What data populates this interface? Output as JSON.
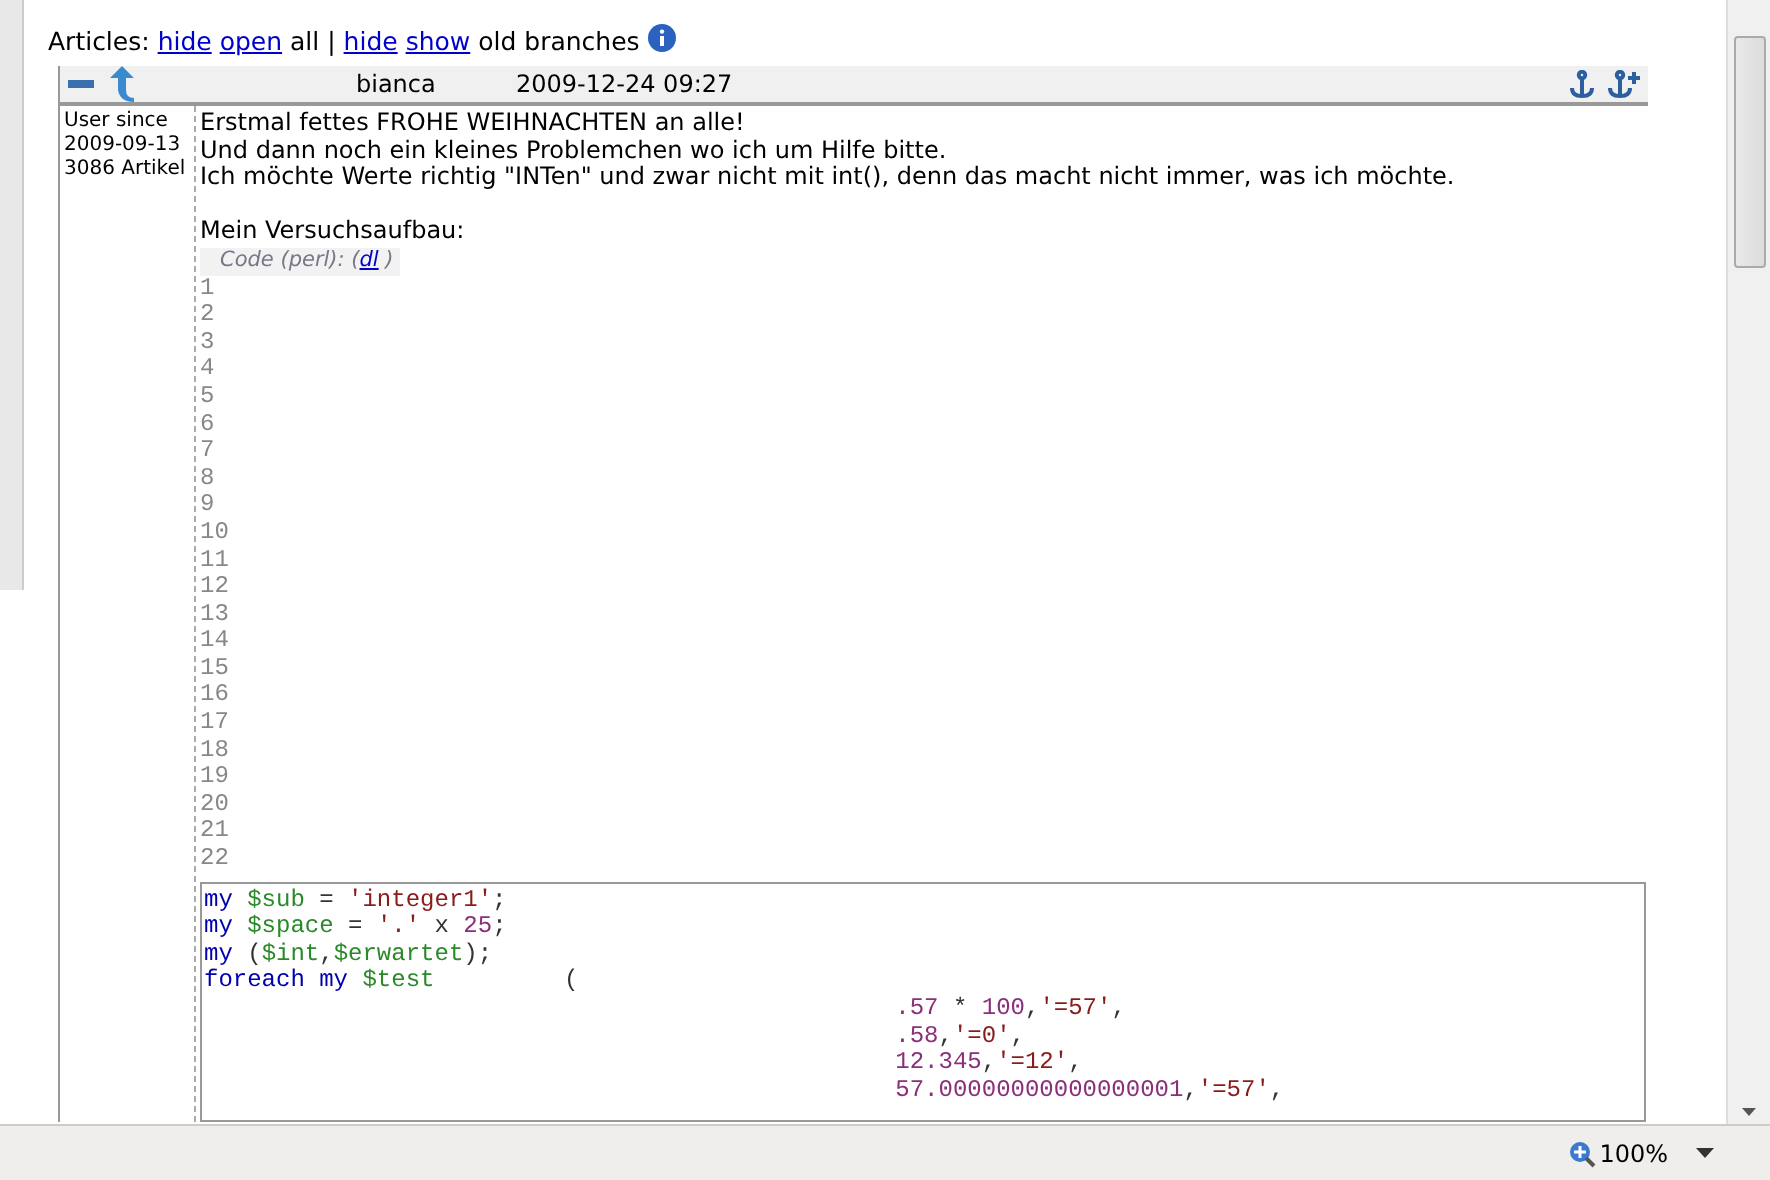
{
  "toolbar": {
    "label": "Articles:",
    "parts": [
      {
        "text": "hide",
        "kind": "link"
      },
      {
        "text": "open",
        "kind": "link"
      },
      {
        "text": "all |",
        "kind": "text"
      },
      {
        "text": "hide",
        "kind": "link"
      },
      {
        "text": "show",
        "kind": "link"
      },
      {
        "text": "old branches",
        "kind": "text"
      }
    ]
  },
  "post": {
    "author": "bianca",
    "date": "2009-12-24 09:27",
    "user_info": [
      "User since",
      "2009-09-13",
      "3086 Artikel"
    ],
    "paragraphs": [
      {
        "text": "Erstmal fettes FROHE WEIHNACHTEN an alle!",
        "gap_before": false
      },
      {
        "text": "Und dann noch ein kleines Problemchen wo ich um Hilfe bitte.",
        "gap_before": false
      },
      {
        "text": "Ich möchte Werte richtig \"INTen\" und zwar nicht mit int(), denn das macht nicht immer, was ich möchte.",
        "gap_before": false
      },
      {
        "text": "Mein Versuchsaufbau:",
        "gap_before": true
      }
    ],
    "code": {
      "caption": "Code (perl): (",
      "caption_link": "dl",
      "caption_end": " )",
      "line_numbers": [
        "1",
        "2",
        "3",
        "4",
        "5",
        "6",
        "7",
        "8",
        "9",
        "10",
        "11",
        "12",
        "13",
        "14",
        "15",
        "16",
        "17",
        "18",
        "19",
        "20",
        "21",
        "22"
      ],
      "lines": [
        {
          "kind": "statement",
          "segments": [
            {
              "t": "my",
              "kind": "keyword"
            },
            {
              "t": " $sub",
              "kind": "variable"
            },
            {
              "t": " = ",
              "kind": "plain"
            },
            {
              "t": "'integer1'",
              "kind": "string"
            },
            {
              "t": ";",
              "kind": "plain"
            }
          ]
        },
        {
          "kind": "statement",
          "segments": [
            {
              "t": "my",
              "kind": "keyword"
            },
            {
              "t": " $space",
              "kind": "variable"
            },
            {
              "t": " = ",
              "kind": "plain"
            },
            {
              "t": "'.'",
              "kind": "string"
            },
            {
              "t": " x ",
              "kind": "plain"
            },
            {
              "t": "25",
              "kind": "number"
            },
            {
              "t": ";",
              "kind": "plain"
            }
          ]
        },
        {
          "kind": "statement",
          "segments": [
            {
              "t": "my",
              "kind": "keyword"
            },
            {
              "t": " (",
              "kind": "plain"
            },
            {
              "t": "$int",
              "kind": "variable"
            },
            {
              "t": ",",
              "kind": "plain"
            },
            {
              "t": "$erwartet",
              "kind": "variable"
            },
            {
              "t": ");",
              "kind": "plain"
            }
          ]
        },
        {
          "kind": "statement",
          "segments": [
            {
              "t": "foreach my",
              "kind": "keyword"
            },
            {
              "t": " $test",
              "kind": "variable"
            },
            {
              "t": "(",
              "kind": "open-paren"
            }
          ]
        },
        {
          "kind": "continuation",
          "segments": [
            {
              "t": ".57",
              "kind": "number"
            },
            {
              "t": " * ",
              "kind": "plain"
            },
            {
              "t": "100",
              "kind": "number"
            },
            {
              "t": ",",
              "kind": "plain"
            },
            {
              "t": "'=57'",
              "kind": "string"
            },
            {
              "t": ",",
              "kind": "plain"
            }
          ]
        },
        {
          "kind": "continuation",
          "segments": [
            {
              "t": ".58",
              "kind": "number"
            },
            {
              "t": ",",
              "kind": "plain"
            },
            {
              "t": "'=0'",
              "kind": "string"
            },
            {
              "t": ",",
              "kind": "plain"
            }
          ]
        },
        {
          "kind": "continuation",
          "segments": [
            {
              "t": "12.345",
              "kind": "number"
            },
            {
              "t": ",",
              "kind": "plain"
            },
            {
              "t": "'=12'",
              "kind": "string"
            },
            {
              "t": ",",
              "kind": "plain"
            }
          ]
        },
        {
          "kind": "continuation",
          "segments": [
            {
              "t": "57.00000000000000001",
              "kind": "number"
            },
            {
              "t": ",",
              "kind": "plain"
            },
            {
              "t": "'=57'",
              "kind": "string"
            },
            {
              "t": ",",
              "kind": "plain"
            }
          ]
        }
      ]
    }
  },
  "status_bar": {
    "zoom": "100%"
  }
}
